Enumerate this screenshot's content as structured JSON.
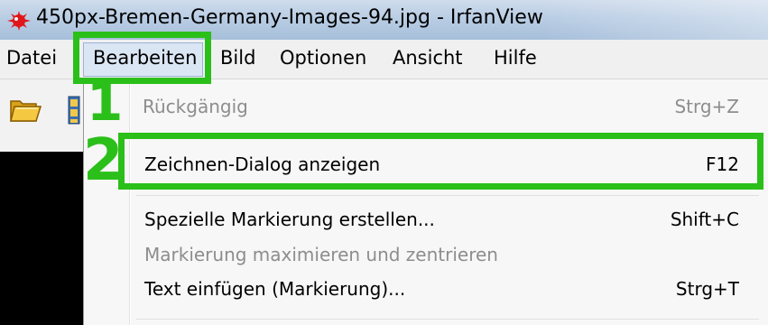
{
  "window": {
    "title": "450px-Bremen-Germany-Images-94.jpg - IrfanView",
    "app_icon": "irfanview-icon"
  },
  "menubar": {
    "items": [
      "Datei",
      "Bearbeiten",
      "Bild",
      "Optionen",
      "Ansicht",
      "Hilfe"
    ],
    "active": "Bearbeiten"
  },
  "toolbar": {
    "icons": [
      "open-folder-icon",
      "filmstrip-icon"
    ]
  },
  "edit_menu": {
    "items": [
      {
        "label": "Rückgängig",
        "shortcut": "Strg+Z",
        "enabled": false
      },
      {
        "label": "Zeichnen-Dialog anzeigen",
        "shortcut": "F12",
        "enabled": true,
        "highlighted": true
      },
      {
        "label": "Spezielle Markierung erstellen...",
        "shortcut": "Shift+C",
        "enabled": true
      },
      {
        "label": "Markierung maximieren und zentrieren",
        "shortcut": "",
        "enabled": false
      },
      {
        "label": "Text einfügen (Markierung)...",
        "shortcut": "Strg+T",
        "enabled": true
      }
    ]
  },
  "annotations": {
    "step1": "1",
    "step2": "2",
    "color": "#2bbf1a"
  }
}
